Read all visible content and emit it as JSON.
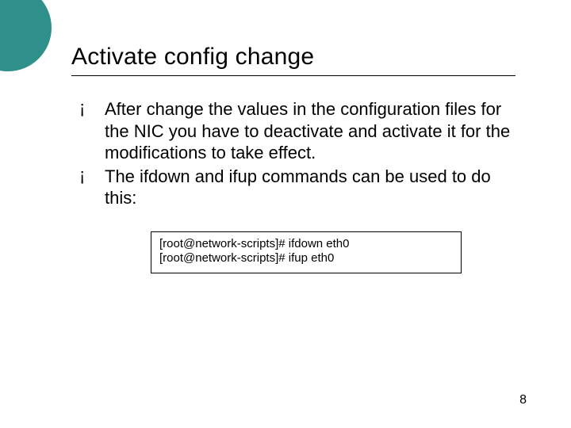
{
  "slide": {
    "title": "Activate config change",
    "bullets": [
      "After change the values in the configuration files for the NIC you have to deactivate and activate it for the modifications to take effect.",
      " The ifdown and ifup commands can be used to do this:"
    ],
    "code": {
      "line1": "[root@network-scripts]# ifdown eth0",
      "line2": "[root@network-scripts]# ifup eth0"
    },
    "page_number": "8"
  }
}
